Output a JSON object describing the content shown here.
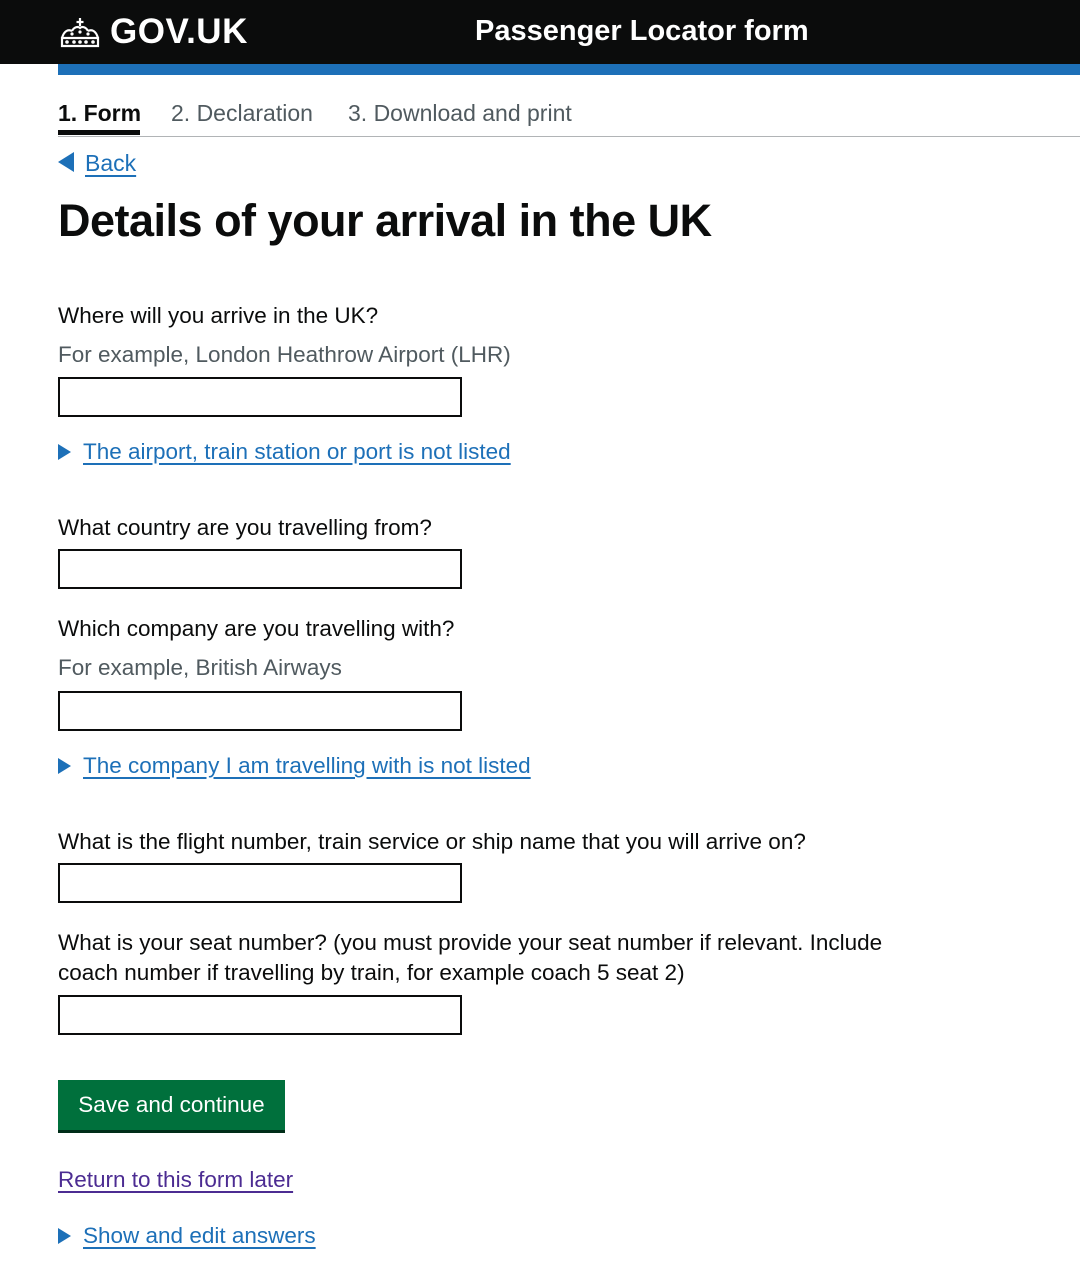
{
  "header": {
    "logo_text": "GOV.UK",
    "service_name": "Passenger Locator form"
  },
  "steps": [
    {
      "label": "1. Form",
      "active": true
    },
    {
      "label": "2. Declaration",
      "active": false
    },
    {
      "label": "3. Download and print",
      "active": false
    }
  ],
  "back_link": "Back",
  "page_title": "Details of your arrival in the UK",
  "fields": {
    "arrival_location": {
      "label": "Where will you arrive in the UK?",
      "hint": "For example, London Heathrow Airport (LHR)",
      "value": "",
      "details_summary": "The airport, train station or port is not listed"
    },
    "country_from": {
      "label": "What country are you travelling from?",
      "value": ""
    },
    "company": {
      "label": "Which company are you travelling with?",
      "hint": "For example, British Airways",
      "value": "",
      "details_summary": "The company I am travelling with is not listed"
    },
    "service_number": {
      "label": "What is the flight number, train service or ship name that you will arrive on?",
      "value": ""
    },
    "seat_number": {
      "label_line1": "What is your seat number? (you must provide your seat number if relevant. Include",
      "label_line2": "coach number if travelling by train, for example coach 5 seat 2)",
      "value": ""
    }
  },
  "actions": {
    "submit_label": "Save and continue",
    "return_later": "Return to this form later",
    "show_answers": "Show and edit answers"
  },
  "colors": {
    "header_bg": "#0b0c0c",
    "brand_blue": "#1d70b8",
    "button_green": "#00703c",
    "visited_link": "#4c2c92",
    "hint_grey": "#505a5f"
  },
  "icons": {
    "logo": "crown-icon",
    "back": "back-arrow-icon",
    "details": "details-arrow-icon"
  }
}
